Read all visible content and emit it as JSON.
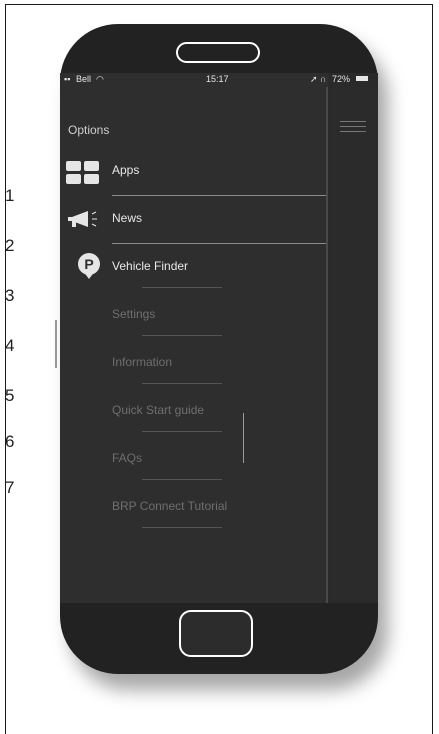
{
  "callouts": [
    "1",
    "2",
    "3",
    "4",
    "5",
    "6",
    "7"
  ],
  "status_bar": {
    "carrier": "Bell",
    "time": "15:17",
    "battery": "72%"
  },
  "menu": {
    "header": "Options",
    "items": [
      {
        "label": "Apps",
        "icon": "apps-grid-icon"
      },
      {
        "label": "News",
        "icon": "megaphone-icon"
      },
      {
        "label": "Vehicle Finder",
        "icon": "parking-pin-icon"
      },
      {
        "label": "Settings"
      },
      {
        "label": "Information"
      },
      {
        "label": "Quick Start guide"
      },
      {
        "label": "FAQs"
      },
      {
        "label": "BRP Connect Tutorial"
      }
    ]
  },
  "colors": {
    "screen_bg": "#2e2e2e",
    "phone_body": "#222222",
    "text_active": "#e8e8e8",
    "text_faded": "#6e6e6e"
  }
}
